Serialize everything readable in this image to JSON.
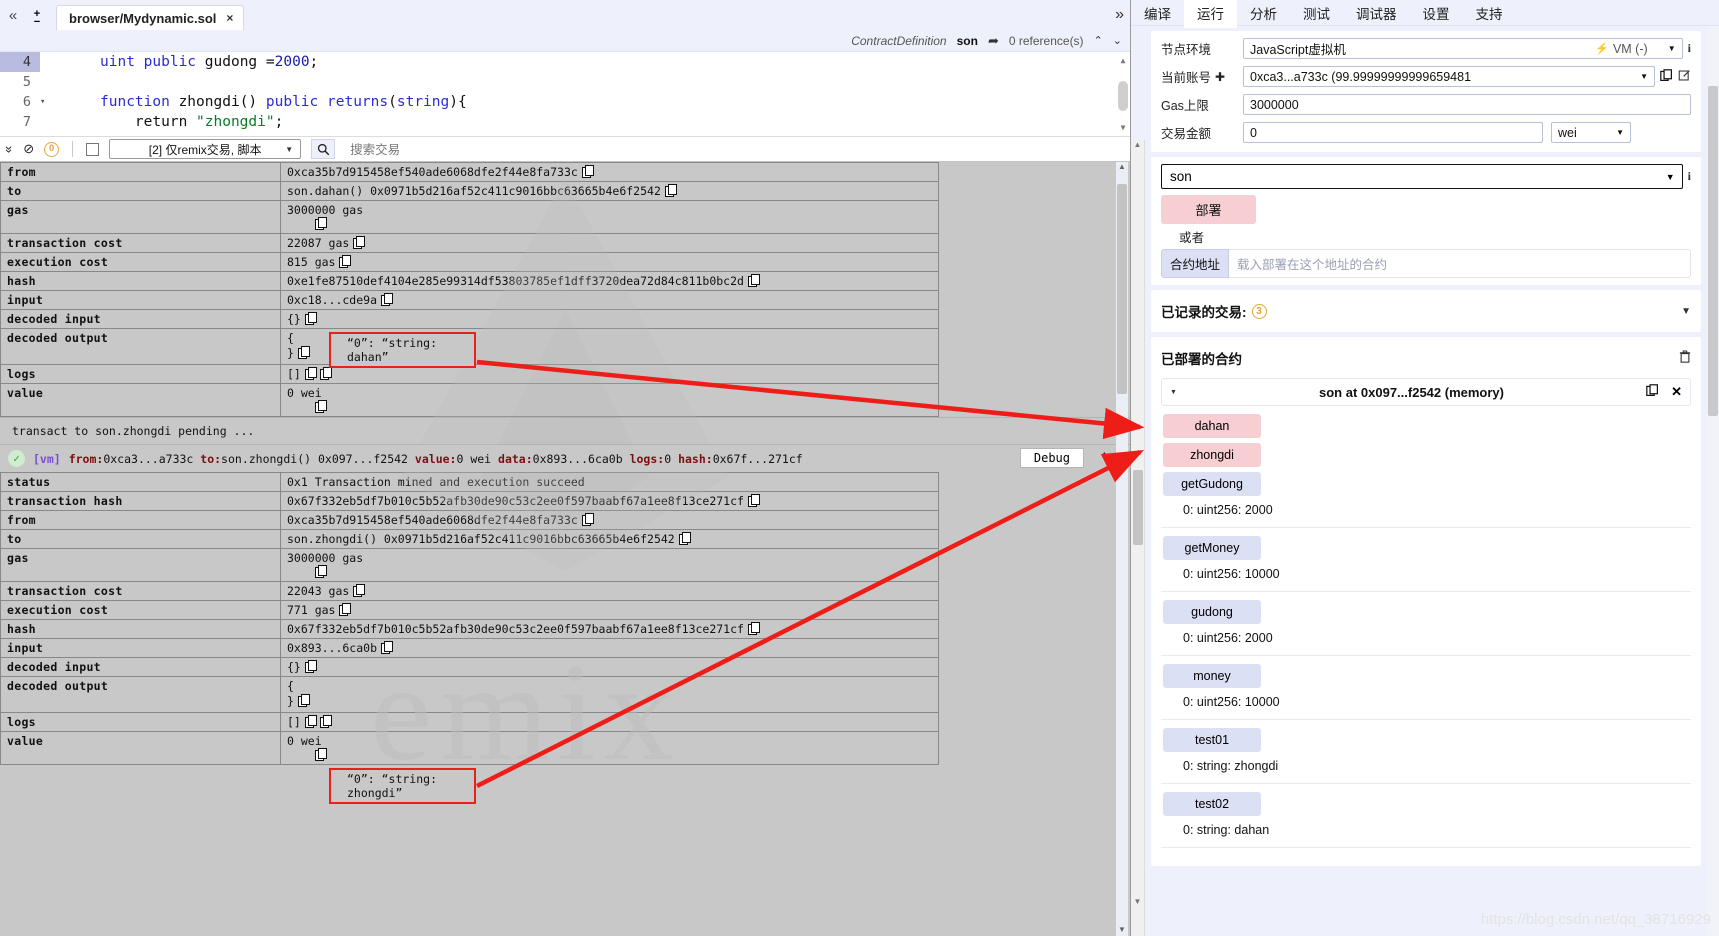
{
  "editor": {
    "tab_label": "browser/Mydynamic.sol",
    "tab_close": "×",
    "collapse_icon": "«",
    "expand_icon": "»",
    "plus": "+",
    "minus": "−",
    "contract_definition_label": "ContractDefinition",
    "contract_name": "son",
    "references": "0 reference(s)",
    "chevron_up": "⌃",
    "chevron_down": "⌄",
    "lines": [
      {
        "num": "4",
        "fold": "",
        "active": true,
        "tokens": [
          {
            "t": "uint",
            "c": "k-type"
          },
          {
            "t": " ",
            "c": ""
          },
          {
            "t": "public",
            "c": "k-kw"
          },
          {
            "t": " gudong ",
            "c": "k-id"
          },
          {
            "t": "=",
            "c": "k-id"
          },
          {
            "t": "2000",
            "c": "k-num"
          },
          {
            "t": ";",
            "c": "k-id"
          }
        ],
        "plain": "    uint public gudong =2000;"
      },
      {
        "num": "5",
        "fold": "",
        "active": false,
        "tokens": [],
        "plain": ""
      },
      {
        "num": "6",
        "fold": "▾",
        "active": false,
        "tokens": [
          {
            "t": "function",
            "c": "k-kw"
          },
          {
            "t": " zhongdi",
            "c": "k-id"
          },
          {
            "t": "() ",
            "c": "k-id"
          },
          {
            "t": "public",
            "c": "k-kw"
          },
          {
            "t": " ",
            "c": ""
          },
          {
            "t": "returns",
            "c": "k-kw"
          },
          {
            "t": "(",
            "c": "k-id"
          },
          {
            "t": "string",
            "c": "k-type"
          },
          {
            "t": "){",
            "c": "k-id"
          }
        ],
        "plain": "    function zhongdi() public returns(string){"
      },
      {
        "num": "7",
        "fold": "",
        "active": false,
        "tokens": [
          {
            "t": "    return ",
            "c": "k-id"
          },
          {
            "t": "\"zhongdi\"",
            "c": "k-str"
          },
          {
            "t": ";",
            "c": "k-id"
          }
        ],
        "plain": "        return \"zhongdi\";"
      }
    ]
  },
  "tx_toolbar": {
    "collapse_all_icon": "»",
    "clear_icon": "⊘",
    "pending_count": "0",
    "checkbox_checked": false,
    "filter_label": "[2] 仅remix交易, 脚本",
    "filter_caret": "▼",
    "search_icon": "⚲",
    "search_placeholder": "搜索交易"
  },
  "tx1": {
    "rows": [
      {
        "label": "from",
        "value": "0xca35b7d915458ef540ade6068dfe2f44e8fa733c",
        "copy": true
      },
      {
        "label": "to",
        "value": "son.dahan() 0x0971b5d216af52c411c9016bbc63665b4e6f2542",
        "copy": true
      },
      {
        "label": "gas",
        "value": "3000000 gas",
        "copy": true,
        "tall": true
      },
      {
        "label": "transaction cost",
        "value": "22087 gas",
        "copy": true
      },
      {
        "label": "execution cost",
        "value": "815 gas",
        "copy": true
      },
      {
        "label": "hash",
        "value": "0xe1fe87510def4104e285e99314df53803785ef1dff3720dea72d84c811b0bc2d",
        "copy": true
      },
      {
        "label": "input",
        "value": "0xc18...cde9a",
        "copy": true
      },
      {
        "label": "decoded input",
        "value": "{}",
        "copy": true
      },
      {
        "label": "decoded output",
        "value": "{",
        "value2": "}",
        "copy": true,
        "decoded": true
      },
      {
        "label": "logs",
        "value": "[]",
        "copy": true,
        "copy2": true
      },
      {
        "label": "value",
        "value": "0 wei",
        "copy": true,
        "tall": true
      }
    ]
  },
  "pending_text": "transact to son.zhongdi pending ...",
  "tx2_header": {
    "vm_tag": "[vm]",
    "parts": [
      {
        "b": "from:",
        "t": "0xca3...a733c"
      },
      {
        "b": "to:",
        "t": "son.zhongdi() 0x097...f2542"
      },
      {
        "b": "value:",
        "t": "0 wei"
      },
      {
        "b": "data:",
        "t": "0x893...6ca0b"
      },
      {
        "b": "logs:",
        "t": "0"
      },
      {
        "b": "hash:",
        "t": "0x67f...271cf"
      }
    ],
    "debug_label": "Debug",
    "chevron": "⌃",
    "status_icon": "✓"
  },
  "tx2": {
    "rows": [
      {
        "label": "status",
        "value": "0x1 Transaction mined and execution succeed",
        "copy": false
      },
      {
        "label": "transaction hash",
        "value": "0x67f332eb5df7b010c5b52afb30de90c53c2ee0f597baabf67a1ee8f13ce271cf",
        "copy": true
      },
      {
        "label": "from",
        "value": "0xca35b7d915458ef540ade6068dfe2f44e8fa733c",
        "copy": true
      },
      {
        "label": "to",
        "value": "son.zhongdi() 0x0971b5d216af52c411c9016bbc63665b4e6f2542",
        "copy": true
      },
      {
        "label": "gas",
        "value": "3000000 gas",
        "copy": true,
        "tall": true
      },
      {
        "label": "transaction cost",
        "value": "22043 gas",
        "copy": true
      },
      {
        "label": "execution cost",
        "value": "771 gas",
        "copy": true
      },
      {
        "label": "hash",
        "value": "0x67f332eb5df7b010c5b52afb30de90c53c2ee0f597baabf67a1ee8f13ce271cf",
        "copy": true
      },
      {
        "label": "input",
        "value": "0x893...6ca0b",
        "copy": true
      },
      {
        "label": "decoded input",
        "value": "{}",
        "copy": true
      },
      {
        "label": "decoded output",
        "value": "{",
        "value2": "}",
        "copy": true,
        "decoded": true
      },
      {
        "label": "logs",
        "value": "[]",
        "copy": true,
        "copy2": true
      },
      {
        "label": "value",
        "value": "0 wei",
        "copy": true,
        "tall": true
      }
    ]
  },
  "annotations": {
    "box1_text": "“0”: “string: dahan”",
    "box2_text": "“0”: “string: zhongdi”",
    "arrow_color": "#ee1d17"
  },
  "right": {
    "tabs": [
      {
        "label": "编译",
        "active": false
      },
      {
        "label": "运行",
        "active": true
      },
      {
        "label": "分析",
        "active": false
      },
      {
        "label": "测试",
        "active": false
      },
      {
        "label": "调试器",
        "active": false
      },
      {
        "label": "设置",
        "active": false
      },
      {
        "label": "支持",
        "active": false
      }
    ],
    "env_label": "节点环境",
    "env_value": "JavaScript虚拟机",
    "env_vm": "VM (-)",
    "env_plug_icon": "⚡",
    "env_info_icon": "i",
    "account_label": "当前账号",
    "account_plus_icon": "⊕",
    "account_value": "0xca3...a733c (99.99999999999659481",
    "account_copy_icon": "copy",
    "account_edit_icon": "✎",
    "gas_label": "Gas上限",
    "gas_value": "3000000",
    "amount_label": "交易金额",
    "amount_value": "0",
    "amount_unit": "wei",
    "contract_select": "son",
    "contract_info_icon": "i",
    "deploy_label": "部署",
    "or_label": "或者",
    "at_address_label": "合约地址",
    "at_address_placeholder": "载入部署在这个地址的合约",
    "recorded_tx_label": "已记录的交易:",
    "recorded_tx_count": "3",
    "deployed_label": "已部署的合约",
    "trash_icon": "Ὕ1",
    "instance_title": "son at 0x097...f2542 (memory)",
    "instance_close": "✕",
    "functions": [
      {
        "name": "dahan",
        "style": "pink",
        "result": null
      },
      {
        "name": "zhongdi",
        "style": "pink",
        "result": null
      },
      {
        "name": "getGudong",
        "style": "blue",
        "result": "0: uint256: 2000"
      },
      {
        "name": "getMoney",
        "style": "blue",
        "result": "0: uint256: 10000"
      },
      {
        "name": "gudong",
        "style": "blue",
        "result": "0: uint256: 2000"
      },
      {
        "name": "money",
        "style": "blue",
        "result": "0: uint256: 10000"
      },
      {
        "name": "test01",
        "style": "blue",
        "result": "0: string: zhongdi"
      },
      {
        "name": "test02",
        "style": "blue",
        "result": "0: string: dahan"
      }
    ]
  },
  "watermark_url": "https://blog.csdn.net/qq_38716929"
}
